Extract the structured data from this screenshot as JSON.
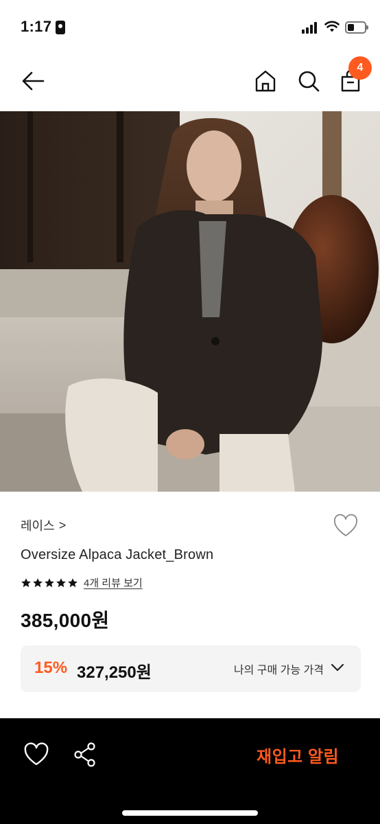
{
  "status": {
    "time": "1:17"
  },
  "nav": {
    "cart_count": "4"
  },
  "product": {
    "brand": "레이스",
    "brand_chevron": ">",
    "name": "Oversize Alpaca Jacket_Brown",
    "stars": 5,
    "review_link": "4개 리뷰 보기",
    "price": "385,000원",
    "discount": "15%",
    "sale_price": "327,250원",
    "my_price_label": "나의 구매 가능 가격"
  },
  "bottom_bar": {
    "restock_label": "재입고 알림"
  },
  "colors": {
    "accent": "#ff5a1f",
    "bottom_bar_bg": "#000000",
    "price_box_bg": "#f4f4f4"
  },
  "icons": [
    "back-arrow-icon",
    "home-icon",
    "search-icon",
    "shopping-bag-icon",
    "heart-icon",
    "share-icon",
    "star-icon",
    "chevron-down-icon"
  ]
}
